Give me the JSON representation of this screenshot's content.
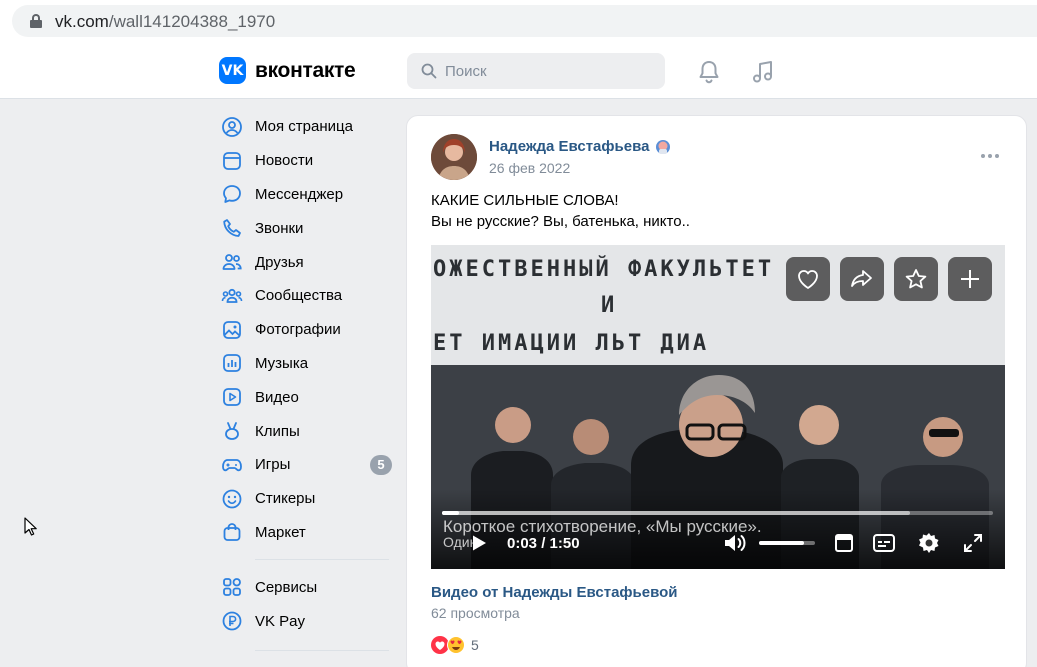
{
  "browser": {
    "url_domain": "vk.com",
    "url_path": "/wall141204388_1970"
  },
  "header": {
    "logo_text": "вконтакте",
    "logo_mark": "VK",
    "search_placeholder": "Поиск"
  },
  "sidebar": {
    "items": [
      {
        "label": "Моя страница",
        "icon": "user-circle-icon"
      },
      {
        "label": "Новости",
        "icon": "news-icon"
      },
      {
        "label": "Мессенджер",
        "icon": "message-icon"
      },
      {
        "label": "Звонки",
        "icon": "phone-icon"
      },
      {
        "label": "Друзья",
        "icon": "friends-icon"
      },
      {
        "label": "Сообщества",
        "icon": "communities-icon"
      },
      {
        "label": "Фотографии",
        "icon": "photo-icon"
      },
      {
        "label": "Музыка",
        "icon": "music-icon"
      },
      {
        "label": "Видео",
        "icon": "video-icon"
      },
      {
        "label": "Клипы",
        "icon": "clips-icon"
      },
      {
        "label": "Игры",
        "icon": "gamepad-icon",
        "badge": "5"
      },
      {
        "label": "Стикеры",
        "icon": "smile-icon"
      },
      {
        "label": "Маркет",
        "icon": "bag-icon"
      }
    ],
    "secondary": [
      {
        "label": "Сервисы",
        "icon": "services-icon"
      },
      {
        "label": "VK Pay",
        "icon": "vkpay-icon"
      }
    ]
  },
  "post": {
    "author": "Надежда Евстафьева",
    "date": "26 фев 2022",
    "text_line1": "КАКИЕ СИЛЬНЫЕ СЛОВА!",
    "text_line2": "Вы не русские? Вы, батенька, никто..",
    "video": {
      "banner_line1": "ОЖЕСТВЕННЫЙ ФАКУЛЬТЕТ",
      "banner_line2": "И",
      "banner_line3": "ЕТ   ИМАЦИИ   ЛЬТ  ДИА",
      "subtitle": "Короткое стихотворение, «Мы русские».",
      "subtitle_line2": "Один",
      "current_time": "0:03",
      "duration": "1:50",
      "progress_fraction": 0.03,
      "buffered_fraction": 0.85,
      "volume_fraction": 0.8
    },
    "video_title": "Видео от Надежды Евстафьевой",
    "views": "62 просмотра",
    "reactions_count": "5"
  },
  "colors": {
    "brand": "#0077ff",
    "link": "#2a5885",
    "muted": "#818c99",
    "background": "#edeef0"
  }
}
